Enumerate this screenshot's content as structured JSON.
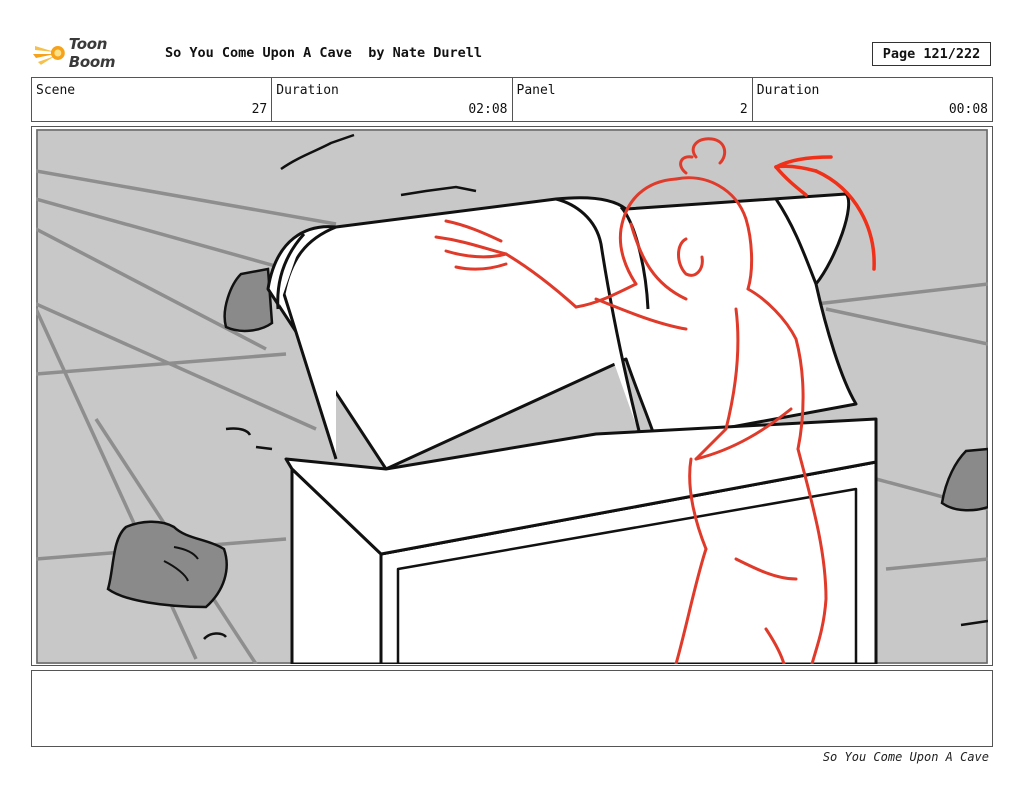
{
  "header": {
    "logo_text": "Toon Boom",
    "title": "So You Come Upon A Cave  by Nate Durell",
    "page": "Page 121/222"
  },
  "info": {
    "scene_label": "Scene",
    "scene_value": "27",
    "scene_duration_label": "Duration",
    "scene_duration_value": "02:08",
    "panel_label": "Panel",
    "panel_value": "2",
    "panel_duration_label": "Duration",
    "panel_duration_value": "00:08"
  },
  "notes": "",
  "footer": "So You Come Upon A Cave",
  "colors": {
    "sketch_red": "#e03a2a",
    "arrow_red": "#f03018",
    "panel_bg": "#c8c8c8",
    "rock_gray": "#8a8a8a",
    "logo_orange": "#f6a21a"
  }
}
